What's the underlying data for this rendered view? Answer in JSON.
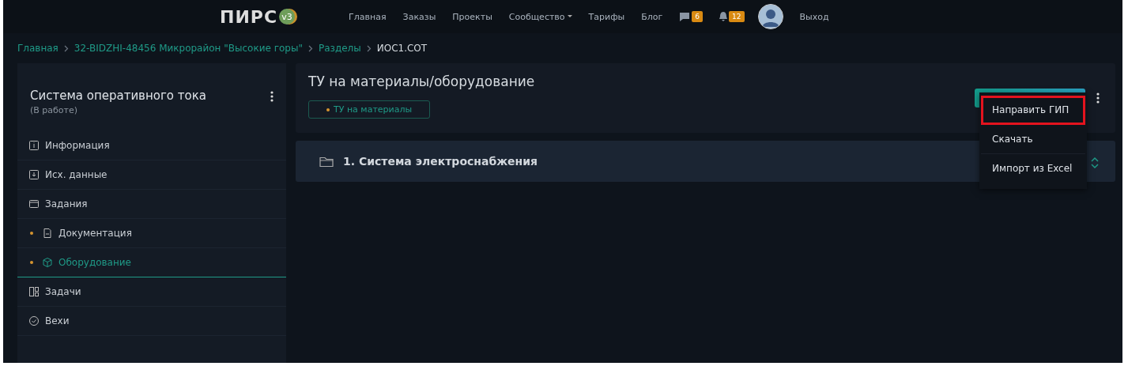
{
  "header": {
    "logo": "ПИРС",
    "version": "v3",
    "nav": [
      {
        "label": "Главная"
      },
      {
        "label": "Заказы"
      },
      {
        "label": "Проекты"
      },
      {
        "label": "Сообщество",
        "dropdown": true
      },
      {
        "label": "Тарифы"
      },
      {
        "label": "Блог"
      }
    ],
    "messages_count": "6",
    "notifications_count": "12",
    "logout": "Выход"
  },
  "breadcrumbs": [
    {
      "label": "Главная",
      "current": false
    },
    {
      "label": "32-BIDZHI-48456 Микрорайон \"Высокие горы\"",
      "current": false
    },
    {
      "label": "Разделы",
      "current": false
    },
    {
      "label": "ИОС1.СОТ",
      "current": true
    }
  ],
  "sidebar": {
    "title": "Система оперативного тока",
    "status": "(В работе)",
    "items": [
      {
        "label": "Информация",
        "marked": false,
        "selected": false
      },
      {
        "label": "Исх. данные",
        "marked": false,
        "selected": false
      },
      {
        "label": "Задания",
        "marked": false,
        "selected": false
      },
      {
        "label": "Документация",
        "marked": true,
        "selected": false
      },
      {
        "label": "Оборудование",
        "marked": true,
        "selected": true
      },
      {
        "label": "Задачи",
        "marked": false,
        "selected": false
      },
      {
        "label": "Вехи",
        "marked": false,
        "selected": false
      }
    ]
  },
  "main": {
    "title": "ТУ на материалы/оборудование",
    "tag": "ТУ на материалы",
    "sections": [
      {
        "label": "1. Система электроснабжения"
      }
    ],
    "menu": [
      {
        "label": "Направить ГИП",
        "highlighted": true
      },
      {
        "label": "Скачать",
        "highlighted": false
      },
      {
        "label": "Импорт из Excel",
        "highlighted": false
      }
    ]
  }
}
